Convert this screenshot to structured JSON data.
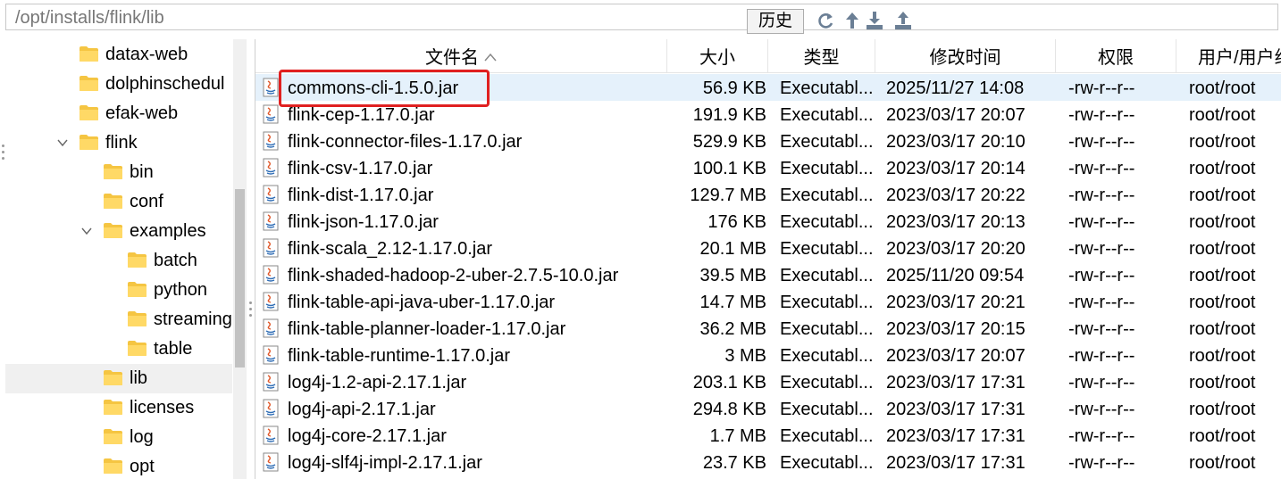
{
  "path_bar": {
    "path": "/opt/installs/flink/lib",
    "history_label": "历史",
    "toolbar_icons": [
      "refresh-icon",
      "up-arrow-icon",
      "download-icon",
      "upload-icon"
    ]
  },
  "tree": {
    "items": [
      {
        "label": "datax-web",
        "depth": 0,
        "expanded": null,
        "selected": false
      },
      {
        "label": "dolphinschedul",
        "depth": 0,
        "expanded": null,
        "selected": false
      },
      {
        "label": "efak-web",
        "depth": 0,
        "expanded": null,
        "selected": false
      },
      {
        "label": "flink",
        "depth": 0,
        "expanded": true,
        "selected": false
      },
      {
        "label": "bin",
        "depth": 1,
        "expanded": null,
        "selected": false
      },
      {
        "label": "conf",
        "depth": 1,
        "expanded": null,
        "selected": false
      },
      {
        "label": "examples",
        "depth": 1,
        "expanded": true,
        "selected": false
      },
      {
        "label": "batch",
        "depth": 2,
        "expanded": null,
        "selected": false
      },
      {
        "label": "python",
        "depth": 2,
        "expanded": null,
        "selected": false
      },
      {
        "label": "streaming",
        "depth": 2,
        "expanded": null,
        "selected": false
      },
      {
        "label": "table",
        "depth": 2,
        "expanded": null,
        "selected": false
      },
      {
        "label": "lib",
        "depth": 1,
        "expanded": null,
        "selected": true
      },
      {
        "label": "licenses",
        "depth": 1,
        "expanded": null,
        "selected": false
      },
      {
        "label": "log",
        "depth": 1,
        "expanded": null,
        "selected": false
      },
      {
        "label": "opt",
        "depth": 1,
        "expanded": null,
        "selected": false
      }
    ]
  },
  "table": {
    "columns": {
      "name": "文件名",
      "size": "大小",
      "type": "类型",
      "mtime": "修改时间",
      "perm": "权限",
      "owner": "用户/用户组"
    },
    "rows": [
      {
        "name": "commons-cli-1.5.0.jar",
        "size": "56.9 KB",
        "type": "Executabl...",
        "mtime": "2025/11/27 14:08",
        "perm": "-rw-r--r--",
        "owner": "root/root"
      },
      {
        "name": "flink-cep-1.17.0.jar",
        "size": "191.9 KB",
        "type": "Executabl...",
        "mtime": "2023/03/17 20:07",
        "perm": "-rw-r--r--",
        "owner": "root/root"
      },
      {
        "name": "flink-connector-files-1.17.0.jar",
        "size": "529.9 KB",
        "type": "Executabl...",
        "mtime": "2023/03/17 20:10",
        "perm": "-rw-r--r--",
        "owner": "root/root"
      },
      {
        "name": "flink-csv-1.17.0.jar",
        "size": "100.1 KB",
        "type": "Executabl...",
        "mtime": "2023/03/17 20:14",
        "perm": "-rw-r--r--",
        "owner": "root/root"
      },
      {
        "name": "flink-dist-1.17.0.jar",
        "size": "129.7 MB",
        "type": "Executabl...",
        "mtime": "2023/03/17 20:22",
        "perm": "-rw-r--r--",
        "owner": "root/root"
      },
      {
        "name": "flink-json-1.17.0.jar",
        "size": "176 KB",
        "type": "Executabl...",
        "mtime": "2023/03/17 20:13",
        "perm": "-rw-r--r--",
        "owner": "root/root"
      },
      {
        "name": "flink-scala_2.12-1.17.0.jar",
        "size": "20.1 MB",
        "type": "Executabl...",
        "mtime": "2023/03/17 20:20",
        "perm": "-rw-r--r--",
        "owner": "root/root"
      },
      {
        "name": "flink-shaded-hadoop-2-uber-2.7.5-10.0.jar",
        "size": "39.5 MB",
        "type": "Executabl...",
        "mtime": "2025/11/20 09:54",
        "perm": "-rw-r--r--",
        "owner": "root/root"
      },
      {
        "name": "flink-table-api-java-uber-1.17.0.jar",
        "size": "14.7 MB",
        "type": "Executabl...",
        "mtime": "2023/03/17 20:21",
        "perm": "-rw-r--r--",
        "owner": "root/root"
      },
      {
        "name": "flink-table-planner-loader-1.17.0.jar",
        "size": "36.2 MB",
        "type": "Executabl...",
        "mtime": "2023/03/17 20:15",
        "perm": "-rw-r--r--",
        "owner": "root/root"
      },
      {
        "name": "flink-table-runtime-1.17.0.jar",
        "size": "3 MB",
        "type": "Executabl...",
        "mtime": "2023/03/17 20:07",
        "perm": "-rw-r--r--",
        "owner": "root/root"
      },
      {
        "name": "log4j-1.2-api-2.17.1.jar",
        "size": "203.1 KB",
        "type": "Executabl...",
        "mtime": "2023/03/17 17:31",
        "perm": "-rw-r--r--",
        "owner": "root/root"
      },
      {
        "name": "log4j-api-2.17.1.jar",
        "size": "294.8 KB",
        "type": "Executabl...",
        "mtime": "2023/03/17 17:31",
        "perm": "-rw-r--r--",
        "owner": "root/root"
      },
      {
        "name": "log4j-core-2.17.1.jar",
        "size": "1.7 MB",
        "type": "Executabl...",
        "mtime": "2023/03/17 17:31",
        "perm": "-rw-r--r--",
        "owner": "root/root"
      },
      {
        "name": "log4j-slf4j-impl-2.17.1.jar",
        "size": "23.7 KB",
        "type": "Executabl...",
        "mtime": "2023/03/17 17:31",
        "perm": "-rw-r--r--",
        "owner": "root/root"
      }
    ]
  },
  "colors": {
    "row_highlight": "#e5f1fb",
    "annotation_box": "#e02020",
    "folder": "#f5c542",
    "tree_selected": "#f0f0f0"
  }
}
